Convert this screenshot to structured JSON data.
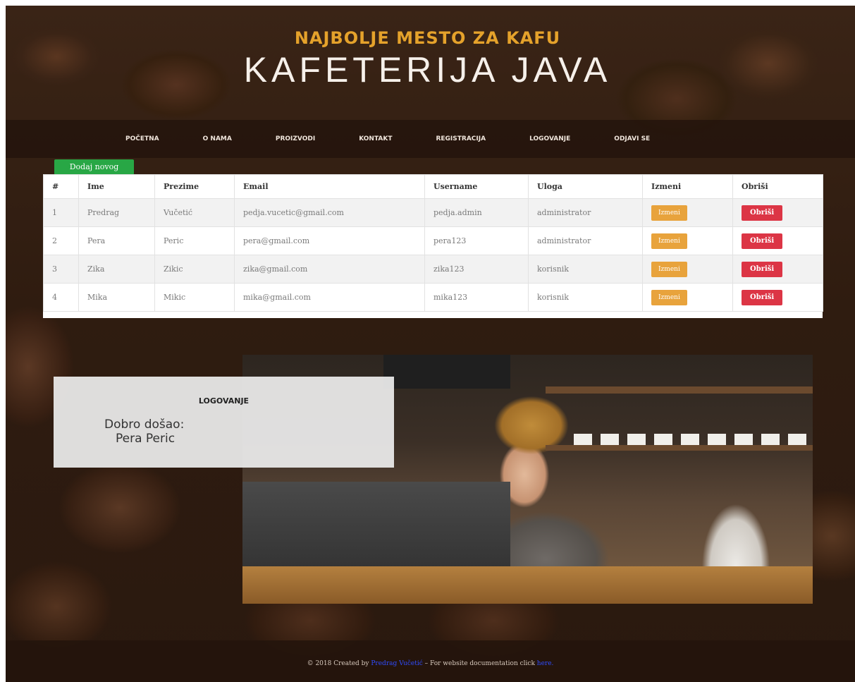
{
  "header": {
    "tagline": "Najbolje mesto za kafu",
    "title": "Kafeterija Java"
  },
  "nav": {
    "items": [
      "Početna",
      "O nama",
      "Proizvodi",
      "Kontakt",
      "Registracija",
      "Logovanje",
      "Odjavi se"
    ]
  },
  "users_table": {
    "add_button": "Dodaj novog",
    "columns": [
      "#",
      "Ime",
      "Prezime",
      "Email",
      "Username",
      "Uloga",
      "Izmeni",
      "Obriši"
    ],
    "edit_label": "Izmeni",
    "delete_label": "Obriši",
    "rows": [
      {
        "id": "1",
        "first_name": "Predrag",
        "last_name": "Vučetić",
        "email": "pedja.vucetic@gmail.com",
        "username": "pedja.admin",
        "role": "administrator"
      },
      {
        "id": "2",
        "first_name": "Pera",
        "last_name": "Peric",
        "email": "pera@gmail.com",
        "username": "pera123",
        "role": "administrator"
      },
      {
        "id": "3",
        "first_name": "Zika",
        "last_name": "Zikic",
        "email": "zika@gmail.com",
        "username": "zika123",
        "role": "korisnik"
      },
      {
        "id": "4",
        "first_name": "Mika",
        "last_name": "Mikic",
        "email": "mika@gmail.com",
        "username": "mika123",
        "role": "korisnik"
      }
    ]
  },
  "login": {
    "title": "Logovanje",
    "greeting": "Dobro došao:",
    "user_name": "Pera Peric"
  },
  "footer": {
    "prefix": "© 2018 Created by",
    "author": "Predrag Vučetić",
    "middle": "– For website documentation click",
    "link": "here."
  },
  "colors": {
    "accent": "#e5a22b",
    "add_button": "#28a745",
    "edit_button": "#e8a33c",
    "delete_button": "#dc3545",
    "link": "#2f4cff"
  }
}
